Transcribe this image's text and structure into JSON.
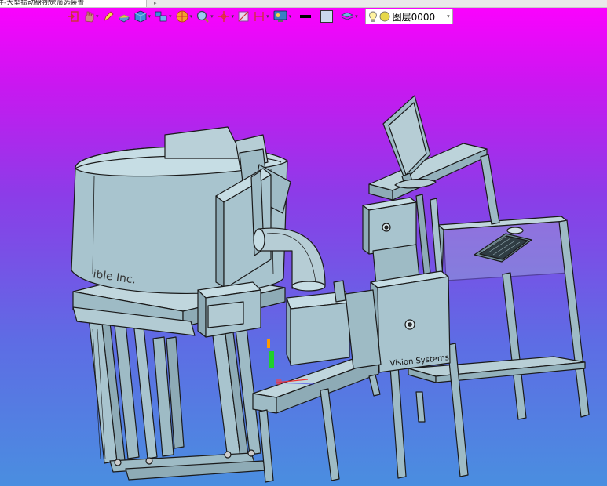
{
  "window": {
    "title": "件-大型振动盘视觉筛选装置"
  },
  "toolbar": {
    "layer_value": "图层0000",
    "icons": [
      "exit-icon",
      "pan-icon",
      "pencil-icon",
      "eraser-icon",
      "cube-view-icon",
      "multi-view-icon",
      "render-icon",
      "zoom-icon",
      "axis-icon",
      "section-icon",
      "dimension-icon",
      "display-mode-icon",
      "line-color",
      "fill-color",
      "layers-icon",
      "bulb-icon",
      "layer-color-dot"
    ]
  },
  "model": {
    "feeder_label": "ible Inc.",
    "cabinet_label": "Vision Systems"
  },
  "colors": {
    "part": "#a8c4ce",
    "part_dark": "#7d9ca8",
    "part_light": "#c6dde4",
    "edge": "#1a1a1a"
  }
}
